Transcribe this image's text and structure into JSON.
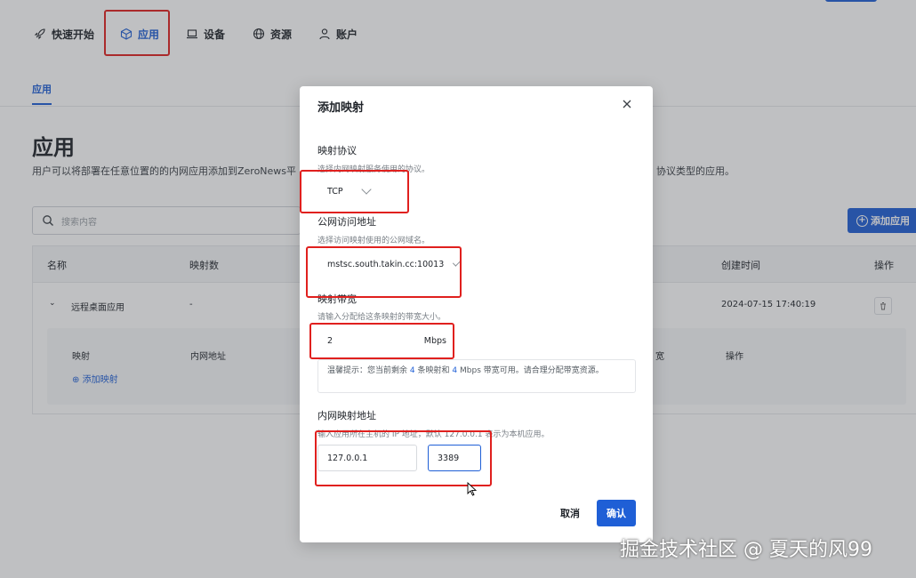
{
  "nav": {
    "items": [
      {
        "label": "快速开始",
        "icon": "rocket-icon"
      },
      {
        "label": "应用",
        "icon": "cube-icon",
        "active": true
      },
      {
        "label": "设备",
        "icon": "laptop-icon"
      },
      {
        "label": "资源",
        "icon": "globe-icon"
      },
      {
        "label": "账户",
        "icon": "user-icon"
      }
    ]
  },
  "subnav": {
    "tab": "应用"
  },
  "page": {
    "title": "应用",
    "desc_left": "用户可以将部署在任意位置的的内网应用添加到ZeroNews平",
    "desc_right": "协议类型的应用。",
    "search_placeholder": "搜索内容",
    "add_button": "添加应用"
  },
  "table": {
    "headers": [
      "名称",
      "映射数",
      "创建时间",
      "操作"
    ],
    "row": {
      "name": "远程桌面应用",
      "count": "-",
      "created": "2024-07-15 17:40:19"
    },
    "sub_headers": [
      "映射",
      "内网地址",
      "宽",
      "操作"
    ],
    "add_mapping": "添加映射"
  },
  "modal": {
    "title": "添加映射",
    "protocol": {
      "label": "映射协议",
      "hint": "选择内网映射服务使用的协议。",
      "value": "TCP"
    },
    "public": {
      "label": "公网访问地址",
      "hint": "选择访问映射使用的公网域名。",
      "value": "mstsc.south.takin.cc:10013"
    },
    "bandwidth": {
      "label": "映射带宽",
      "hint": "请输入分配给这条映射的带宽大小。",
      "value": "2",
      "unit": "Mbps"
    },
    "tip": {
      "text1": "温馨提示：您当前剩余",
      "n1": "4",
      "text2": "条映射和",
      "n2": "4",
      "text3": "Mbps 带宽可用。请合理分配带宽资源。"
    },
    "internal": {
      "label": "内网映射地址",
      "hint": "输入应用所在主机的 IP 地址，默认 127.0.0.1 表示为本机应用。",
      "ip": "127.0.0.1",
      "port": "3389"
    },
    "cancel": "取消",
    "confirm": "确认"
  },
  "watermark": "掘金技术社区 @ 夏天的风99",
  "colors": {
    "accent": "#1f5fd6",
    "highlight": "#e0201e"
  }
}
